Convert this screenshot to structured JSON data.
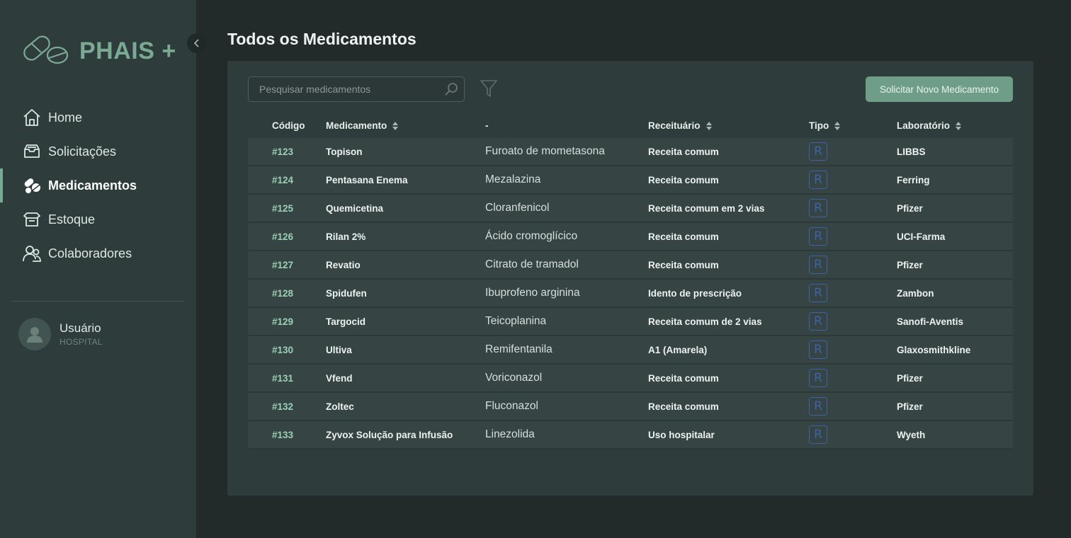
{
  "app": {
    "name": "PHAIS +"
  },
  "colors": {
    "accent": "#7aaa94",
    "button": "#6e9e88",
    "code": "#9bd0b6",
    "badge": "#3a63a8"
  },
  "sidebar": {
    "items": [
      {
        "label": "Home",
        "icon": "home-icon",
        "active": false
      },
      {
        "label": "Solicitações",
        "icon": "inbox-icon",
        "active": false
      },
      {
        "label": "Medicamentos",
        "icon": "pills-icon",
        "active": true
      },
      {
        "label": "Estoque",
        "icon": "open-box-icon",
        "active": false
      },
      {
        "label": "Colaboradores",
        "icon": "users-icon",
        "active": false
      }
    ],
    "user": {
      "name": "Usuário",
      "role": "HOSPITAL"
    }
  },
  "main": {
    "title": "Todos os Medicamentos",
    "search": {
      "placeholder": "Pesquisar medicamentos",
      "value": ""
    },
    "new_button": "Solicitar Novo Medicamento",
    "table": {
      "headers": {
        "code": "Código",
        "name": "Medicamento",
        "active": "-",
        "prescription": "Receituário",
        "type": "Tipo",
        "lab": "Laboratório"
      },
      "rows": [
        {
          "code": "#123",
          "name": "Topison",
          "active": "Furoato de mometasona",
          "prescription": "Receita comum",
          "type": "R",
          "lab": "LIBBS"
        },
        {
          "code": "#124",
          "name": "Pentasana Enema",
          "active": "Mezalazina",
          "prescription": "Receita comum",
          "type": "R",
          "lab": "Ferring"
        },
        {
          "code": "#125",
          "name": "Quemicetina",
          "active": "Cloranfenicol",
          "prescription": "Receita comum em 2 vias",
          "type": "R",
          "lab": "Pfizer"
        },
        {
          "code": "#126",
          "name": "Rilan 2%",
          "active": "Ácido cromoglícico",
          "prescription": "Receita comum",
          "type": "R",
          "lab": "UCI-Farma"
        },
        {
          "code": "#127",
          "name": "Revatio",
          "active": "Citrato de tramadol",
          "prescription": "Receita comum",
          "type": "R",
          "lab": "Pfizer"
        },
        {
          "code": "#128",
          "name": "Spidufen",
          "active": "Ibuprofeno arginina",
          "prescription": "Idento de prescrição",
          "type": "R",
          "lab": "Zambon"
        },
        {
          "code": "#129",
          "name": "Targocid",
          "active": "Teicoplanina",
          "prescription": "Receita comum de 2 vias",
          "type": "R",
          "lab": "Sanofi-Aventis"
        },
        {
          "code": "#130",
          "name": "Ultiva",
          "active": "Remifentanila",
          "prescription": "A1 (Amarela)",
          "type": "R",
          "lab": "Glaxosmithkline"
        },
        {
          "code": "#131",
          "name": "Vfend",
          "active": "Voriconazol",
          "prescription": "Receita comum",
          "type": "R",
          "lab": "Pfizer"
        },
        {
          "code": "#132",
          "name": "Zoltec",
          "active": "Fluconazol",
          "prescription": "Receita comum",
          "type": "R",
          "lab": "Pfizer"
        },
        {
          "code": "#133",
          "name": "Zyvox Solução para Infusão",
          "active": "Linezolida",
          "prescription": "Uso hospitalar",
          "type": "R",
          "lab": "Wyeth"
        }
      ]
    }
  }
}
